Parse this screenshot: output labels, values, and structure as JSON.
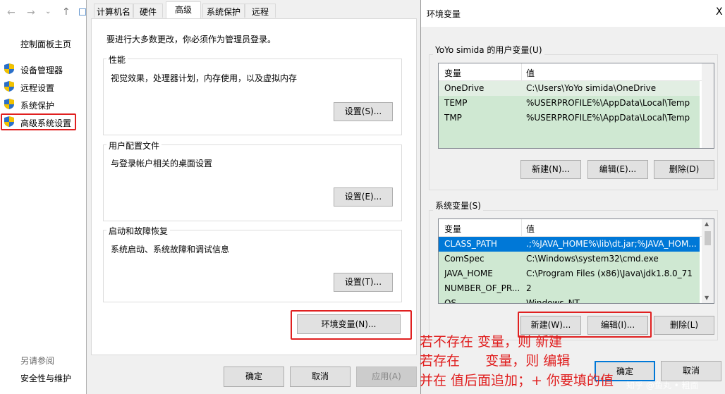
{
  "left_panel": {
    "home": "控制面板主页",
    "items": [
      "设备管理器",
      "远程设置",
      "系统保护",
      "高级系统设置"
    ],
    "see_also": "另请参阅",
    "security": "安全性与维护"
  },
  "sysprops": {
    "tabs": [
      "计算机名",
      "硬件",
      "高级",
      "系统保护",
      "远程"
    ],
    "admin_note": "要进行大多数更改，你必须作为管理员登录。",
    "performance": {
      "title": "性能",
      "desc": "视觉效果，处理器计划，内存使用，以及虚拟内存",
      "button": "设置(S)..."
    },
    "profiles": {
      "title": "用户配置文件",
      "desc": "与登录帐户相关的桌面设置",
      "button": "设置(E)..."
    },
    "startup": {
      "title": "启动和故障恢复",
      "desc": "系统启动、系统故障和调试信息",
      "button": "设置(T)..."
    },
    "env_button": "环境变量(N)...",
    "ok": "确定",
    "cancel": "取消",
    "apply": "应用(A)"
  },
  "envvars": {
    "title": "环境变量",
    "close": "X",
    "user_group": "YoYo simida 的用户变量(U)",
    "col_var": "变量",
    "col_val": "值",
    "user_rows": [
      {
        "name": "OneDrive",
        "value": "C:\\Users\\YoYo simida\\OneDrive"
      },
      {
        "name": "TEMP",
        "value": "%USERPROFILE%\\AppData\\Local\\Temp"
      },
      {
        "name": "TMP",
        "value": "%USERPROFILE%\\AppData\\Local\\Temp"
      }
    ],
    "user_buttons": {
      "new": "新建(N)...",
      "edit": "编辑(E)...",
      "delete": "删除(D)"
    },
    "sys_group": "系统变量(S)",
    "sys_rows": [
      {
        "name": "CLASS_PATH",
        "value": ".;%JAVA_HOME%\\lib\\dt.jar;%JAVA_HOM..."
      },
      {
        "name": "ComSpec",
        "value": "C:\\Windows\\system32\\cmd.exe"
      },
      {
        "name": "JAVA_HOME",
        "value": "C:\\Program Files (x86)\\Java\\jdk1.8.0_71"
      },
      {
        "name": "NUMBER_OF_PR...",
        "value": "2"
      },
      {
        "name": "OS",
        "value": "Windows_NT"
      }
    ],
    "sys_buttons": {
      "new": "新建(W)...",
      "edit": "编辑(I)...",
      "delete": "删除(L)"
    },
    "ok": "确定",
    "cancel": "取消"
  },
  "annotations": [
    "若不存在 变量，则 新建",
    "若存在      变量，则 编辑",
    "并在 值后面追加；+ 你要填的值"
  ],
  "watermark": "知乎 @鱼丸 • 粗面",
  "colors": {
    "highlight": "#cfe8d2",
    "selected": "#0078d7",
    "annotation": "#e02020"
  }
}
